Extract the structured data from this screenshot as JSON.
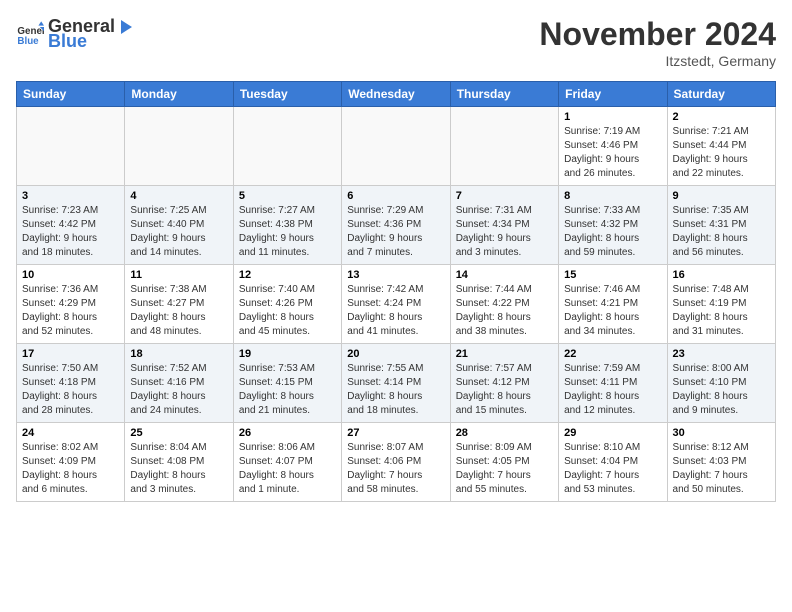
{
  "header": {
    "logo_general": "General",
    "logo_blue": "Blue",
    "month": "November 2024",
    "location": "Itzstedt, Germany"
  },
  "weekdays": [
    "Sunday",
    "Monday",
    "Tuesday",
    "Wednesday",
    "Thursday",
    "Friday",
    "Saturday"
  ],
  "weeks": [
    [
      {
        "day": "",
        "info": ""
      },
      {
        "day": "",
        "info": ""
      },
      {
        "day": "",
        "info": ""
      },
      {
        "day": "",
        "info": ""
      },
      {
        "day": "",
        "info": ""
      },
      {
        "day": "1",
        "info": "Sunrise: 7:19 AM\nSunset: 4:46 PM\nDaylight: 9 hours\nand 26 minutes."
      },
      {
        "day": "2",
        "info": "Sunrise: 7:21 AM\nSunset: 4:44 PM\nDaylight: 9 hours\nand 22 minutes."
      }
    ],
    [
      {
        "day": "3",
        "info": "Sunrise: 7:23 AM\nSunset: 4:42 PM\nDaylight: 9 hours\nand 18 minutes."
      },
      {
        "day": "4",
        "info": "Sunrise: 7:25 AM\nSunset: 4:40 PM\nDaylight: 9 hours\nand 14 minutes."
      },
      {
        "day": "5",
        "info": "Sunrise: 7:27 AM\nSunset: 4:38 PM\nDaylight: 9 hours\nand 11 minutes."
      },
      {
        "day": "6",
        "info": "Sunrise: 7:29 AM\nSunset: 4:36 PM\nDaylight: 9 hours\nand 7 minutes."
      },
      {
        "day": "7",
        "info": "Sunrise: 7:31 AM\nSunset: 4:34 PM\nDaylight: 9 hours\nand 3 minutes."
      },
      {
        "day": "8",
        "info": "Sunrise: 7:33 AM\nSunset: 4:32 PM\nDaylight: 8 hours\nand 59 minutes."
      },
      {
        "day": "9",
        "info": "Sunrise: 7:35 AM\nSunset: 4:31 PM\nDaylight: 8 hours\nand 56 minutes."
      }
    ],
    [
      {
        "day": "10",
        "info": "Sunrise: 7:36 AM\nSunset: 4:29 PM\nDaylight: 8 hours\nand 52 minutes."
      },
      {
        "day": "11",
        "info": "Sunrise: 7:38 AM\nSunset: 4:27 PM\nDaylight: 8 hours\nand 48 minutes."
      },
      {
        "day": "12",
        "info": "Sunrise: 7:40 AM\nSunset: 4:26 PM\nDaylight: 8 hours\nand 45 minutes."
      },
      {
        "day": "13",
        "info": "Sunrise: 7:42 AM\nSunset: 4:24 PM\nDaylight: 8 hours\nand 41 minutes."
      },
      {
        "day": "14",
        "info": "Sunrise: 7:44 AM\nSunset: 4:22 PM\nDaylight: 8 hours\nand 38 minutes."
      },
      {
        "day": "15",
        "info": "Sunrise: 7:46 AM\nSunset: 4:21 PM\nDaylight: 8 hours\nand 34 minutes."
      },
      {
        "day": "16",
        "info": "Sunrise: 7:48 AM\nSunset: 4:19 PM\nDaylight: 8 hours\nand 31 minutes."
      }
    ],
    [
      {
        "day": "17",
        "info": "Sunrise: 7:50 AM\nSunset: 4:18 PM\nDaylight: 8 hours\nand 28 minutes."
      },
      {
        "day": "18",
        "info": "Sunrise: 7:52 AM\nSunset: 4:16 PM\nDaylight: 8 hours\nand 24 minutes."
      },
      {
        "day": "19",
        "info": "Sunrise: 7:53 AM\nSunset: 4:15 PM\nDaylight: 8 hours\nand 21 minutes."
      },
      {
        "day": "20",
        "info": "Sunrise: 7:55 AM\nSunset: 4:14 PM\nDaylight: 8 hours\nand 18 minutes."
      },
      {
        "day": "21",
        "info": "Sunrise: 7:57 AM\nSunset: 4:12 PM\nDaylight: 8 hours\nand 15 minutes."
      },
      {
        "day": "22",
        "info": "Sunrise: 7:59 AM\nSunset: 4:11 PM\nDaylight: 8 hours\nand 12 minutes."
      },
      {
        "day": "23",
        "info": "Sunrise: 8:00 AM\nSunset: 4:10 PM\nDaylight: 8 hours\nand 9 minutes."
      }
    ],
    [
      {
        "day": "24",
        "info": "Sunrise: 8:02 AM\nSunset: 4:09 PM\nDaylight: 8 hours\nand 6 minutes."
      },
      {
        "day": "25",
        "info": "Sunrise: 8:04 AM\nSunset: 4:08 PM\nDaylight: 8 hours\nand 3 minutes."
      },
      {
        "day": "26",
        "info": "Sunrise: 8:06 AM\nSunset: 4:07 PM\nDaylight: 8 hours\nand 1 minute."
      },
      {
        "day": "27",
        "info": "Sunrise: 8:07 AM\nSunset: 4:06 PM\nDaylight: 7 hours\nand 58 minutes."
      },
      {
        "day": "28",
        "info": "Sunrise: 8:09 AM\nSunset: 4:05 PM\nDaylight: 7 hours\nand 55 minutes."
      },
      {
        "day": "29",
        "info": "Sunrise: 8:10 AM\nSunset: 4:04 PM\nDaylight: 7 hours\nand 53 minutes."
      },
      {
        "day": "30",
        "info": "Sunrise: 8:12 AM\nSunset: 4:03 PM\nDaylight: 7 hours\nand 50 minutes."
      }
    ]
  ]
}
